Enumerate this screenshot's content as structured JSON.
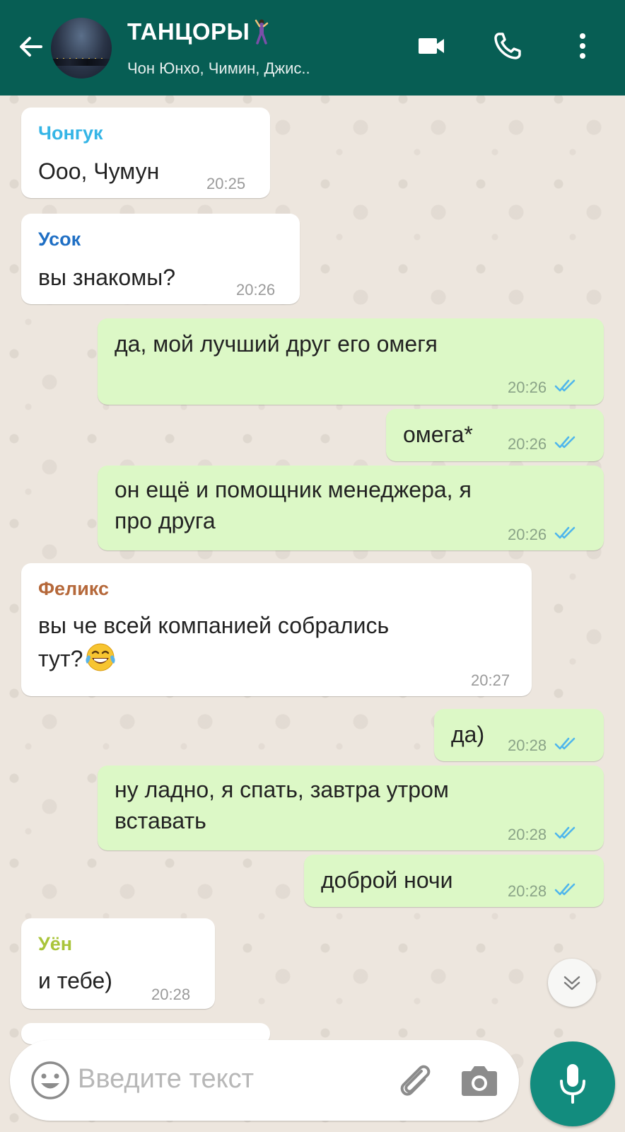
{
  "header": {
    "title": "ТАНЦОРЫ",
    "subtitle": "Чон Юнхо, Чимин, Джис..",
    "color": "#075e54"
  },
  "messages": [
    {
      "dir": "in",
      "sender": "Чонгук",
      "sender_color": "#35b5e6",
      "text": "Ооо, Чумун",
      "time": "20:25"
    },
    {
      "dir": "in",
      "sender": "Усок",
      "sender_color": "#1f6fc4",
      "text": "вы знакомы?",
      "time": "20:26"
    },
    {
      "dir": "out",
      "text": "да, мой лучший друг его омегя",
      "time": "20:26",
      "read": true
    },
    {
      "dir": "out",
      "text": "омега*",
      "time": "20:26",
      "read": true
    },
    {
      "dir": "out",
      "text_lines": [
        "он ещё и помощник менеджера, я",
        "про друга"
      ],
      "time": "20:26",
      "read": true
    },
    {
      "dir": "in",
      "sender": "Феликс",
      "sender_color": "#b5683a",
      "text_lines": [
        "вы че всей компанией собрались",
        "тут?"
      ],
      "emoji": "face-with-tears-of-joy",
      "time": "20:27"
    },
    {
      "dir": "out",
      "text": "да)",
      "time": "20:28",
      "read": true
    },
    {
      "dir": "out",
      "text_lines": [
        "ну ладно, я спать, завтра утром",
        "вставать"
      ],
      "time": "20:28",
      "read": true
    },
    {
      "dir": "out",
      "text": "доброй ночи",
      "time": "20:28",
      "read": true
    },
    {
      "dir": "in",
      "sender": "Уён",
      "sender_color": "#a9c43a",
      "text": "и тебе)",
      "time": "20:28"
    }
  ],
  "composer": {
    "placeholder": "Введите текст",
    "icons": [
      "emoji-icon",
      "attach-icon",
      "camera-icon",
      "mic-icon"
    ]
  },
  "colors": {
    "incoming": "#ffffff",
    "outgoing": "#dcf8c6",
    "read_ticks": "#4fb6ec",
    "mic": "#128c7e"
  }
}
